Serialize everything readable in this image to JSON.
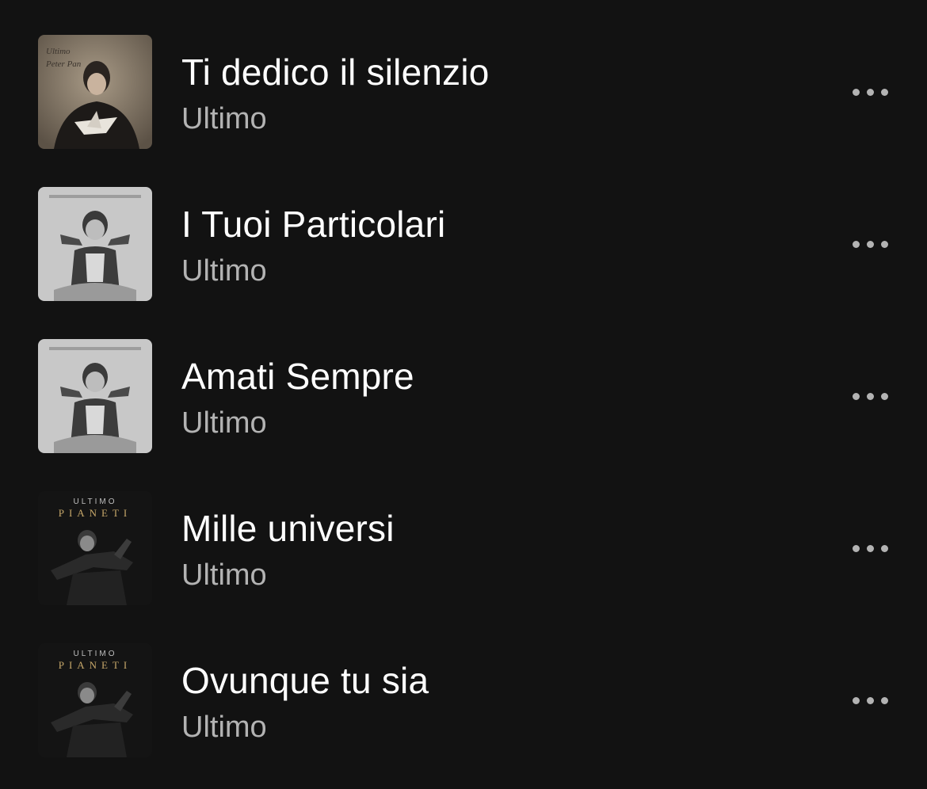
{
  "tracks": [
    {
      "title": "Ti dedico il silenzio",
      "artist": "Ultimo",
      "cover": "peter-pan-cover"
    },
    {
      "title": "I Tuoi Particolari",
      "artist": "Ultimo",
      "cover": "delle-favole-cover"
    },
    {
      "title": "Amati Sempre",
      "artist": "Ultimo",
      "cover": "delle-favole-cover"
    },
    {
      "title": "Mille universi",
      "artist": "Ultimo",
      "cover": "pianeti-cover"
    },
    {
      "title": "Ovunque tu sia",
      "artist": "Ultimo",
      "cover": "pianeti-cover"
    }
  ],
  "more_icon": "more-horizontal-icon",
  "colors": {
    "background": "#121212",
    "title": "#ffffff",
    "subtitle": "#b3b3b3",
    "pianeti_gold": "#c7a86a"
  }
}
